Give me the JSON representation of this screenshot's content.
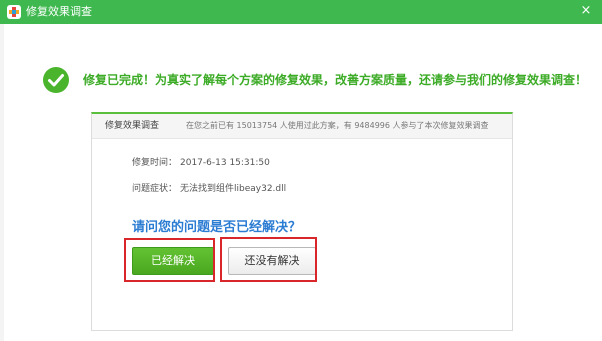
{
  "window": {
    "title": "修复效果调查",
    "app_icon": "plus-cross-icon",
    "close_label": "×",
    "accent_color": "#3fb94f"
  },
  "main": {
    "headline": "修复已完成！为真实了解每个方案的修复效果，改善方案质量，还请参与我们的修复效果调查！",
    "headline_color": "#3cab26"
  },
  "card": {
    "title": "修复效果调查",
    "stats": "在您之前已有 15013754 人使用过此方案，有 9484996 人参与了本次修复效果调查",
    "rows": [
      {
        "label": "修复时间：",
        "value": "2017-6-13 15:31:50"
      },
      {
        "label": "问题症状：",
        "value": "无法找到组件libeay32.dll"
      }
    ],
    "question": "请问您的问题是否已经解决？",
    "question_color": "#2b7cd3",
    "buttons": {
      "solved": "已经解决",
      "unsolved": "还没有解决"
    },
    "highlight_color": "#d8262b"
  }
}
